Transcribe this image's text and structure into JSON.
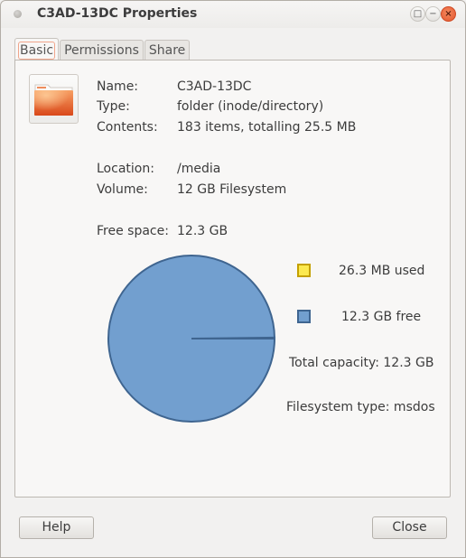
{
  "window": {
    "title": "C3AD-13DC Properties",
    "controls": {
      "maximize": "□",
      "minimize": "−",
      "close": "×"
    }
  },
  "tabs": [
    {
      "label": "Basic",
      "active": true
    },
    {
      "label": "Permissions",
      "active": false
    },
    {
      "label": "Share",
      "active": false
    }
  ],
  "basic": {
    "icon": "folder-icon",
    "fields": [
      {
        "label": "Name:",
        "value": "C3AD-13DC"
      },
      {
        "label": "Type:",
        "value": "folder (inode/directory)"
      },
      {
        "label": "Contents:",
        "value": "183 items, totalling 25.5 MB"
      },
      {
        "label": "Location:",
        "value": "/media"
      },
      {
        "label": "Volume:",
        "value": "12 GB Filesystem"
      },
      {
        "label": "Free space:",
        "value": "12.3 GB"
      }
    ]
  },
  "usage": {
    "used_label": "26.3 MB used",
    "free_label": "12.3 GB free",
    "total_label": "Total capacity: 12.3 GB",
    "fstype_label": "Filesystem type: msdos",
    "colors": {
      "used_fill": "#fce94f",
      "used_stroke": "#c4a000",
      "free_fill": "#729fcf",
      "free_stroke": "#3f6590"
    },
    "used_fraction": 0.002
  },
  "buttons": {
    "help": "Help",
    "close": "Close"
  }
}
